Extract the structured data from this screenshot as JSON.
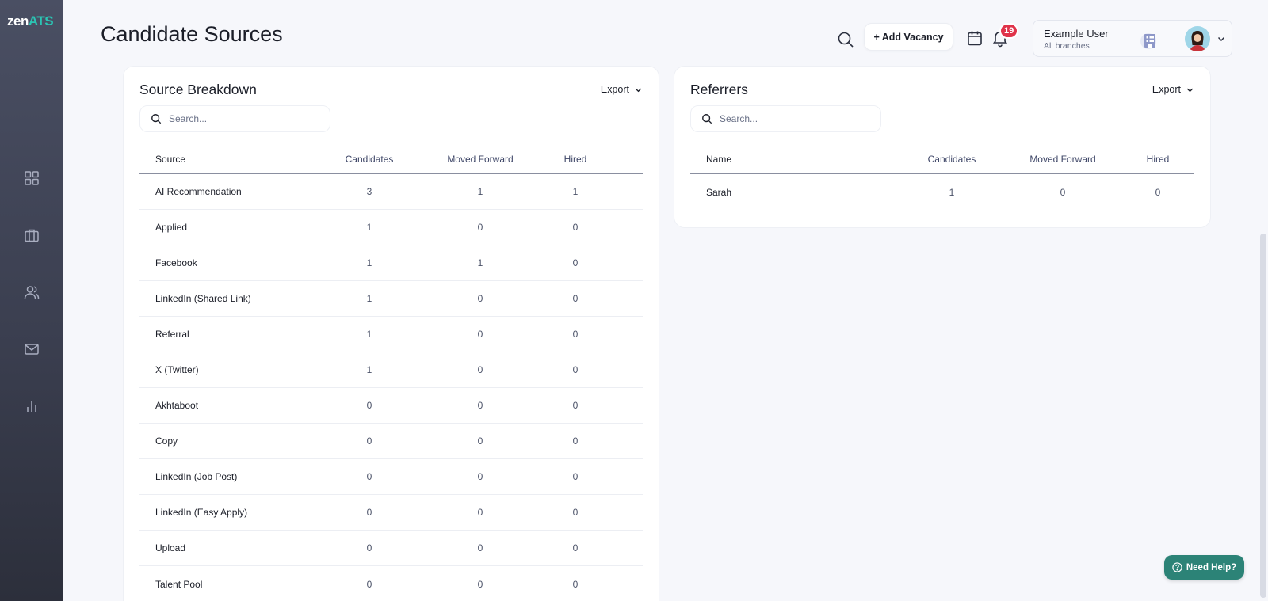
{
  "app": {
    "logo_main": "zen",
    "logo_accent": "ATS",
    "accent_color": "#2bc5b4"
  },
  "sidebar": {
    "items": [
      {
        "icon": "dashboard-icon"
      },
      {
        "icon": "briefcase-icon"
      },
      {
        "icon": "users-icon"
      },
      {
        "icon": "mail-icon"
      },
      {
        "icon": "bar-chart-icon"
      }
    ]
  },
  "header": {
    "title": "Candidate Sources",
    "add_vacancy_label": "+ Add Vacancy",
    "notifications_count": "19",
    "user": {
      "name": "Example User",
      "scope": "All branches"
    }
  },
  "source_breakdown": {
    "title": "Source Breakdown",
    "export_label": "Export",
    "search_placeholder": "Search...",
    "columns": [
      "Source",
      "Candidates",
      "Moved Forward",
      "Hired"
    ],
    "rows": [
      {
        "name": "AI Recommendation",
        "candidates": "3",
        "moved_forward": "1",
        "hired": "1"
      },
      {
        "name": "Applied",
        "candidates": "1",
        "moved_forward": "0",
        "hired": "0"
      },
      {
        "name": "Facebook",
        "candidates": "1",
        "moved_forward": "1",
        "hired": "0"
      },
      {
        "name": "LinkedIn (Shared Link)",
        "candidates": "1",
        "moved_forward": "0",
        "hired": "0"
      },
      {
        "name": "Referral",
        "candidates": "1",
        "moved_forward": "0",
        "hired": "0"
      },
      {
        "name": "X (Twitter)",
        "candidates": "1",
        "moved_forward": "0",
        "hired": "0"
      },
      {
        "name": "Akhtaboot",
        "candidates": "0",
        "moved_forward": "0",
        "hired": "0"
      },
      {
        "name": "Copy",
        "candidates": "0",
        "moved_forward": "0",
        "hired": "0"
      },
      {
        "name": "LinkedIn (Job Post)",
        "candidates": "0",
        "moved_forward": "0",
        "hired": "0"
      },
      {
        "name": "LinkedIn (Easy Apply)",
        "candidates": "0",
        "moved_forward": "0",
        "hired": "0"
      },
      {
        "name": "Upload",
        "candidates": "0",
        "moved_forward": "0",
        "hired": "0"
      },
      {
        "name": "Talent Pool",
        "candidates": "0",
        "moved_forward": "0",
        "hired": "0"
      }
    ]
  },
  "referrers": {
    "title": "Referrers",
    "export_label": "Export",
    "search_placeholder": "Search...",
    "columns": [
      "Name",
      "Candidates",
      "Moved Forward",
      "Hired"
    ],
    "rows": [
      {
        "name": "Sarah",
        "candidates": "1",
        "moved_forward": "0",
        "hired": "0"
      }
    ]
  },
  "help": {
    "label": "Need Help?"
  }
}
